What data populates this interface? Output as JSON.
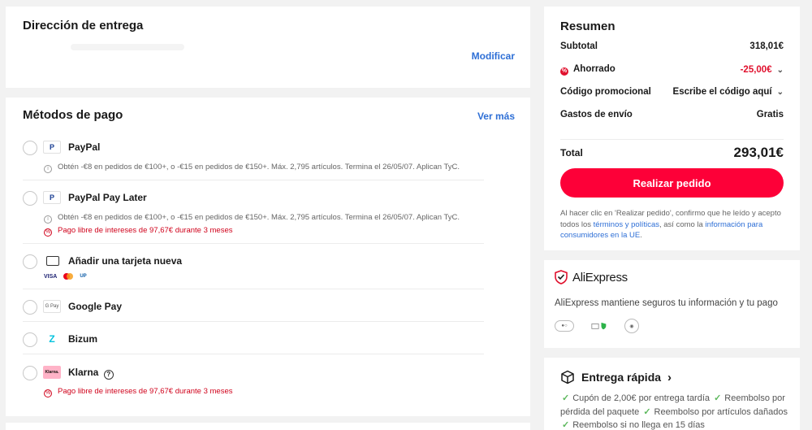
{
  "address": {
    "title": "Dirección de entrega",
    "modify_label": "Modificar"
  },
  "payment": {
    "title": "Métodos de pago",
    "more_label": "Ver más",
    "methods": [
      {
        "name": "PayPal",
        "logo": "P",
        "note": "Obtén -€8 en pedidos de €100+, o -€15 en pedidos de €150+. Máx. 2,795 artículos. Termina el 26/05/07. Aplican TyC."
      },
      {
        "name": "PayPal Pay Later",
        "logo": "P",
        "note": "Obtén -€8 en pedidos de €100+, o -€15 en pedidos de €150+. Máx. 2,795 artículos. Termina el 26/05/07. Aplican TyC.",
        "promo": "Pago libre de intereses de 97,67€ durante 3 meses"
      },
      {
        "name": "Añadir una tarjeta nueva",
        "brands": [
          "VISA",
          "MC",
          "UP"
        ]
      },
      {
        "name": "Google Pay",
        "logo": "G Pay"
      },
      {
        "name": "Bizum",
        "logo": "Z"
      },
      {
        "name": "Klarna",
        "logo": "Klarna.",
        "help_icon": "?",
        "promo": "Pago libre de intereses de 97,67€ durante 3 meses"
      }
    ]
  },
  "summary": {
    "title": "Resumen",
    "subtotal_label": "Subtotal",
    "subtotal_value": "318,01€",
    "saved_label": "Ahorrado",
    "saved_value": "-25,00€",
    "promo_label": "Código promocional",
    "promo_placeholder": "Escribe el código aquí",
    "shipping_label": "Gastos de envío",
    "shipping_value": "Gratis",
    "total_label": "Total",
    "total_value": "293,01€",
    "order_button": "Realizar pedido",
    "legal_1": "Al hacer clic en 'Realizar pedido', confirmo que he leído y acepto todos los ",
    "legal_link_1": "términos y políticas",
    "legal_2": ", así como la ",
    "legal_link_2": "información para consumidores en la UE",
    "legal_3": "."
  },
  "trust": {
    "brand": "AliExpress",
    "text": "AliExpress mantiene seguros tu información y tu pago"
  },
  "delivery": {
    "title": "Entrega rápida",
    "items": [
      "Cupón de 2,00€ por entrega tardía",
      "Reembolso por pérdida del paquete",
      "Reembolso por artículos dañados",
      "Reembolso si no llega en 15 días"
    ]
  },
  "colors": {
    "accent": "#fd0038",
    "link": "#2e6fd6",
    "discount": "#e0102d",
    "promo": "#d0021b"
  }
}
